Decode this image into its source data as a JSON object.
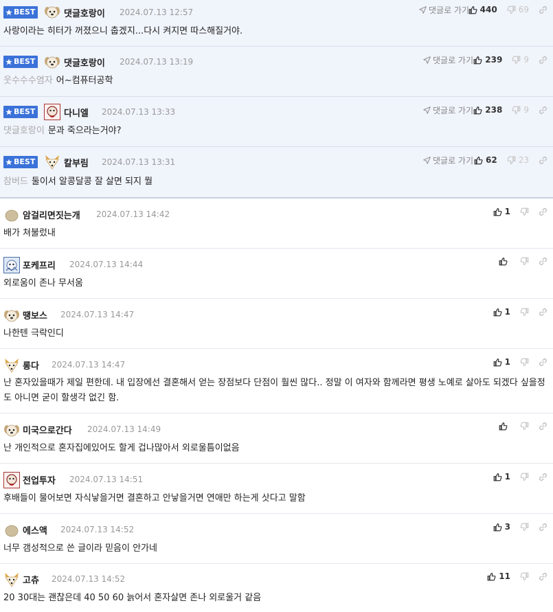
{
  "labels": {
    "best": "BEST",
    "goto": "댓글로 가기"
  },
  "colors": {
    "best_bg": "#f0f4fb",
    "badge": "#3b72d9"
  },
  "best_comments": [
    {
      "avatar": "puppy",
      "nick": "댓글호랑이",
      "date": "2024.07.13 12:57",
      "likes": "440",
      "dislikes": "69",
      "mention": "",
      "text": "사랑이라는 히터가 꺼졌으니 춥겠지...다시 켜지면 따스해질거야."
    },
    {
      "avatar": "puppy",
      "nick": "댓글호랑이",
      "date": "2024.07.13 13:19",
      "likes": "239",
      "dislikes": "9",
      "mention": "웃수수수염자",
      "text": "어~컴퓨터공학"
    },
    {
      "avatar": "photo-red",
      "nick": "다니엘",
      "date": "2024.07.13 13:33",
      "likes": "238",
      "dislikes": "9",
      "mention": "댓글호랑이",
      "text": "문과 죽으라는거야?"
    },
    {
      "avatar": "fox",
      "nick": "칼부림",
      "date": "2024.07.13 13:31",
      "likes": "62",
      "dislikes": "23",
      "mention": "참버드",
      "text": "둘이서 알콩달콩 잘 살면 되지 뭘"
    }
  ],
  "comments": [
    {
      "avatar": "blob",
      "nick": "암걸리면짓는개",
      "date": "2024.07.13 14:42",
      "likes": "1",
      "text": "배가 쳐불렀내"
    },
    {
      "avatar": "photo-blue",
      "nick": "포케프리",
      "date": "2024.07.13 14:44",
      "likes": "",
      "text": "외로움이 존나 무서움"
    },
    {
      "avatar": "puppy",
      "nick": "땡보스",
      "date": "2024.07.13 14:47",
      "likes": "1",
      "text": "나한텐 극락인디"
    },
    {
      "avatar": "fox",
      "nick": "롱다",
      "date": "2024.07.13 14:47",
      "likes": "1",
      "text": "난 혼자있을때가 제일 편한데. 내 입장에선 결혼해서 얻는 장점보다 단점이 훨씬 많다.. 정말 이 여자와 함께라면 평생 노예로 살아도 되겠다 싶을정도 아니면 굳이 할생각 없긴 함."
    },
    {
      "avatar": "puppy",
      "nick": "미국으로간다",
      "date": "2024.07.13 14:49",
      "likes": "",
      "text": "난 개인적으로 혼자집에있어도 할게 겁나많아서 외로울틈이없음"
    },
    {
      "avatar": "photo-red",
      "nick": "전업투자",
      "date": "2024.07.13 14:51",
      "likes": "1",
      "text": "후배들이 물어보면 자식낳을거면 결혼하고 안낳을거면 연애만 하는게 삿다고 말함"
    },
    {
      "avatar": "blob",
      "nick": "에스액",
      "date": "2024.07.13 14:52",
      "likes": "3",
      "text": "너무 갬성적으로 쓴 글이라 믿음이 안가네"
    },
    {
      "avatar": "fox",
      "nick": "고츄",
      "date": "2024.07.13 14:52",
      "likes": "11",
      "text": "20 30대는 괜찮은데 40 50 60 늙어서 혼자살면 존나 외로울거 같음"
    }
  ]
}
